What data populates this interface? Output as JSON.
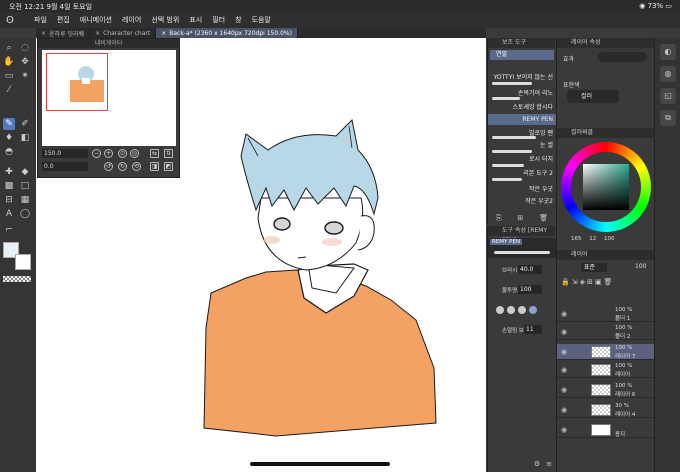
{
  "status": {
    "time_date": "오전 12:21  9월 4일 토요일",
    "battery": "73%"
  },
  "menu": {
    "items": [
      "파일",
      "편집",
      "애니메이션",
      "레이어",
      "선택 범위",
      "표시",
      "필터",
      "창",
      "도움말"
    ]
  },
  "tabs": [
    {
      "label": "윤하루 잇라퀘"
    },
    {
      "label": "Character chart"
    },
    {
      "label": "Back-a* (2360 x 1640px 720dpi 150.0%)"
    }
  ],
  "navigator": {
    "title": "내비게이터",
    "zoom": "150.0",
    "rotation": "0.0"
  },
  "brush_panel": {
    "title": "보조 도구",
    "category": "연필",
    "items": [
      "YOTTYI 보이지 않는 선",
      "손목기어 리노",
      "스토셰잉 합시다",
      "REMY PEN",
      "빌로잉 펜",
      "눈 썰",
      "로시 터치",
      "리본 도구 2",
      "작은 우굿",
      "작은 우굿2"
    ],
    "selected_index": 3
  },
  "tool_property": {
    "title": "도구 속성 [REMY PEN]",
    "name": "REMY PEN",
    "brush_size_label": "브러시 크기",
    "brush_size": "40.0",
    "opacity_label": "불투명도",
    "opacity": "100",
    "stabilizer_label": "손떨림 보정",
    "stabilizer": "11"
  },
  "layer_property": {
    "title": "레이어 속성",
    "effect_label": "효과",
    "expression_label": "표현색",
    "expression_value": "컬러"
  },
  "color_panel": {
    "title": "컬러써클",
    "values": [
      "165",
      "12",
      "100"
    ]
  },
  "layer_panel": {
    "title": "레이어",
    "blend_mode": "표준",
    "opacity": "100",
    "layers": [
      {
        "name": "폴더 1",
        "opacity": "100 %"
      },
      {
        "name": "폴더 2",
        "opacity": "100 %"
      },
      {
        "name": "레이어 7",
        "opacity": "100 %"
      },
      {
        "name": "레이어",
        "opacity": "100 %"
      },
      {
        "name": "레이어 6",
        "opacity": "100 %"
      },
      {
        "name": "레이어 4",
        "opacity": "30 %"
      },
      {
        "name": "용지",
        "opacity": ""
      }
    ]
  },
  "colors": {
    "accent": "#5879b8",
    "hair": "#b8d8e8",
    "sweater": "#f3a263",
    "outline": "#1a1a1a"
  }
}
